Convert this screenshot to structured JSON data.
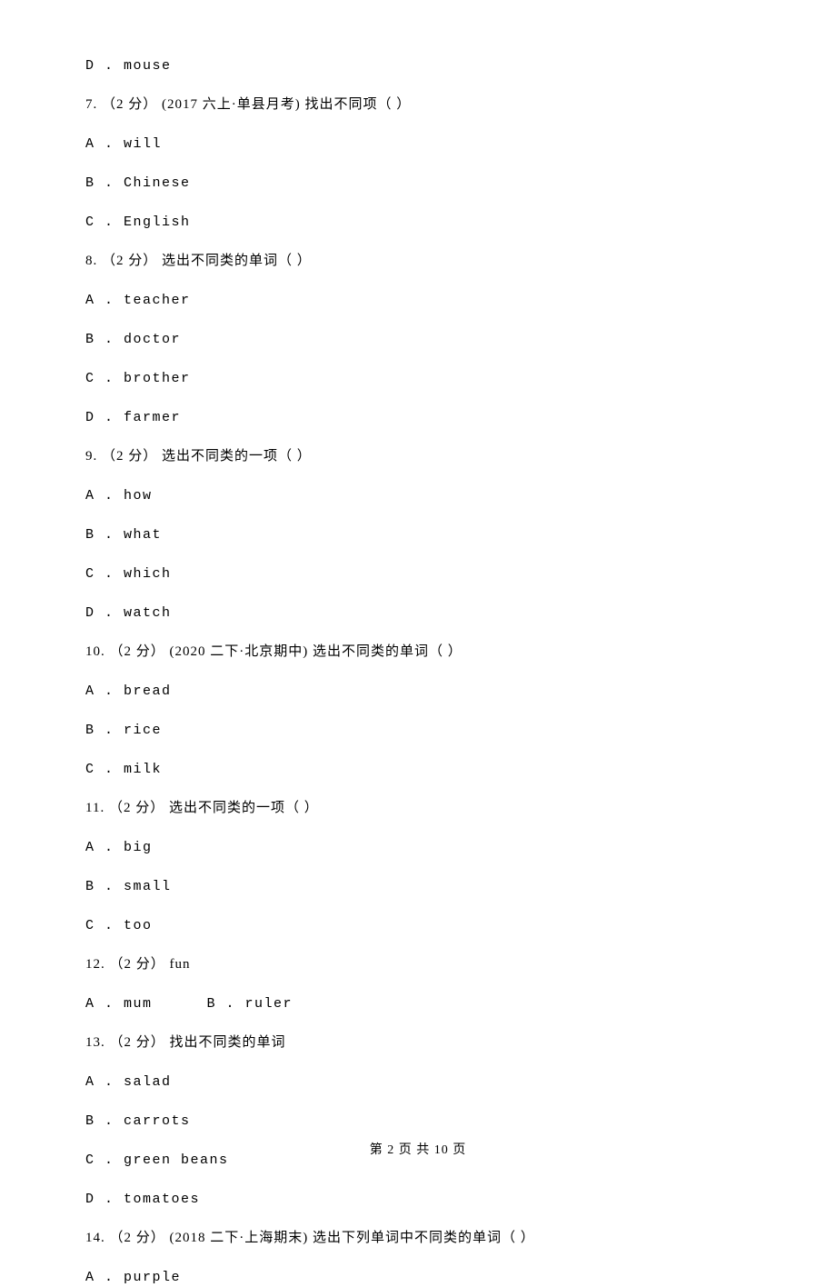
{
  "q6_d": "D . mouse",
  "q7": {
    "stem": "7. （2 分） (2017 六上·单县月考) 找出不同项（   ）",
    "A": "A . will",
    "B": "B . Chinese",
    "C": "C . English"
  },
  "q8": {
    "stem": "8. （2 分） 选出不同类的单词（   ）",
    "A": "A . teacher",
    "B": "B . doctor",
    "C": "C . brother",
    "D": "D . farmer"
  },
  "q9": {
    "stem": "9. （2 分） 选出不同类的一项（   ）",
    "A": "A . how",
    "B": "B . what",
    "C": "C . which",
    "D": "D . watch"
  },
  "q10": {
    "stem": "10. （2 分） (2020 二下·北京期中) 选出不同类的单词（   ）",
    "A": "A . bread",
    "B": "B . rice",
    "C": "C . milk"
  },
  "q11": {
    "stem": "11. （2 分） 选出不同类的一项（   ）",
    "A": "A . big",
    "B": "B . small",
    "C": "C . too"
  },
  "q12": {
    "stem": "12. （2 分） fun",
    "A": "A . mum",
    "B": "B . ruler"
  },
  "q13": {
    "stem": "13. （2 分） 找出不同类的单词",
    "A": "A . salad",
    "B": "B . carrots",
    "C": "C . green beans",
    "D": "D . tomatoes"
  },
  "q14": {
    "stem": "14. （2 分） (2018 二下·上海期末) 选出下列单词中不同类的单词（   ）",
    "A": "A . purple"
  },
  "pager": "第 2 页 共 10 页"
}
